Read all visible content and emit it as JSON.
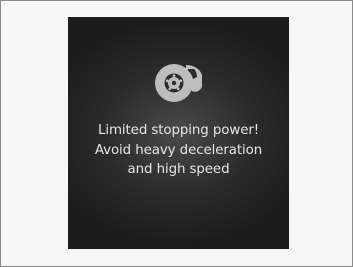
{
  "warning": {
    "icon": "brake-disc-icon",
    "lines": [
      "Limited stopping power!",
      "Avoid heavy deceleration",
      "and high speed"
    ]
  }
}
